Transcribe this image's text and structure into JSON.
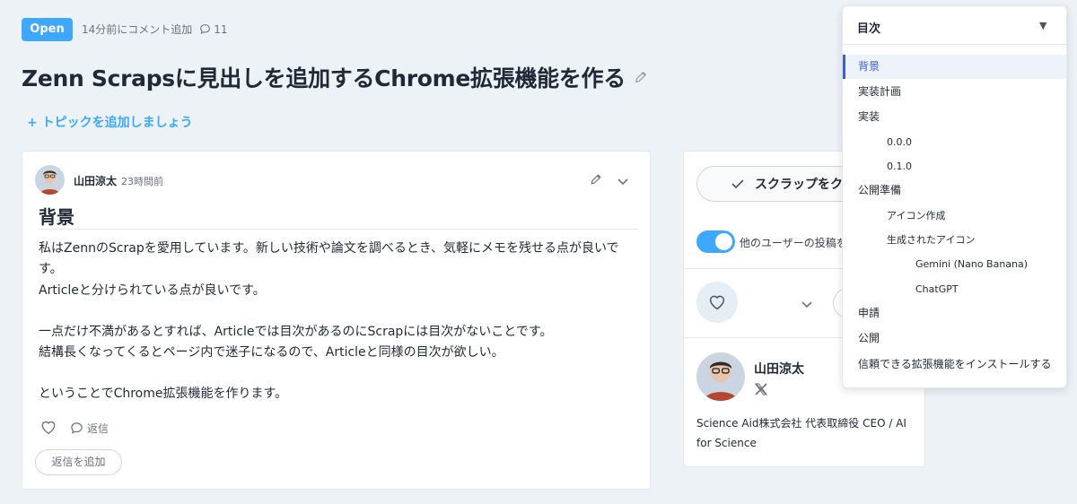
{
  "header": {
    "status": "Open",
    "last_comment": "14分前にコメント追加",
    "comment_count": "11",
    "title": "Zenn Scrapsに見出しを追加するChrome拡張機能を作る",
    "add_topic": "+ トピックを追加しましょう"
  },
  "post": {
    "author": "山田涼太",
    "time": "23時間前",
    "heading": "背景",
    "paragraphs": [
      "私はZennのScrapを愛用しています。新しい技術や論文を調べるとき、気軽にメモを残せる点が良いです。",
      "Articleと分けられている点が良いです。",
      "一点だけ不満があるとすれば、Articleでは目次があるのにScrapには目次がないことです。",
      "結構長くなってくるとページ内で迷子になるので、Articleと同様の目次が欲しい。",
      "ということでChrome拡張機能を作ります。"
    ],
    "reply_label": "返信",
    "add_reply_label": "返信を追加"
  },
  "sidebar": {
    "close_button": "スクラップをクロ",
    "toggle_label": "他のユーザーの投稿を",
    "toggle_on": true,
    "profile": {
      "name": "山田涼太",
      "bio": "Science Aid株式会社 代表取締役 CEO / AI for Science"
    }
  },
  "toc": {
    "title": "目次",
    "items": [
      {
        "label": "背景",
        "level": 1,
        "active": true
      },
      {
        "label": "実装計画",
        "level": 1
      },
      {
        "label": "実装",
        "level": 1
      },
      {
        "label": "0.0.0",
        "level": 2
      },
      {
        "label": "0.1.0",
        "level": 2
      },
      {
        "label": "公開準備",
        "level": 1
      },
      {
        "label": "アイコン作成",
        "level": 2
      },
      {
        "label": "生成されたアイコン",
        "level": 2
      },
      {
        "label": "Gemini (Nano Banana)",
        "level": 3
      },
      {
        "label": "ChatGPT",
        "level": 3
      },
      {
        "label": "申請",
        "level": 1
      },
      {
        "label": "公開",
        "level": 1
      },
      {
        "label": "信頼できる拡張機能をインストールする",
        "level": 1
      }
    ]
  },
  "colors": {
    "accent": "#3ea8ff",
    "background": "#edf2f7",
    "toc_active": "#3b5bdb"
  }
}
